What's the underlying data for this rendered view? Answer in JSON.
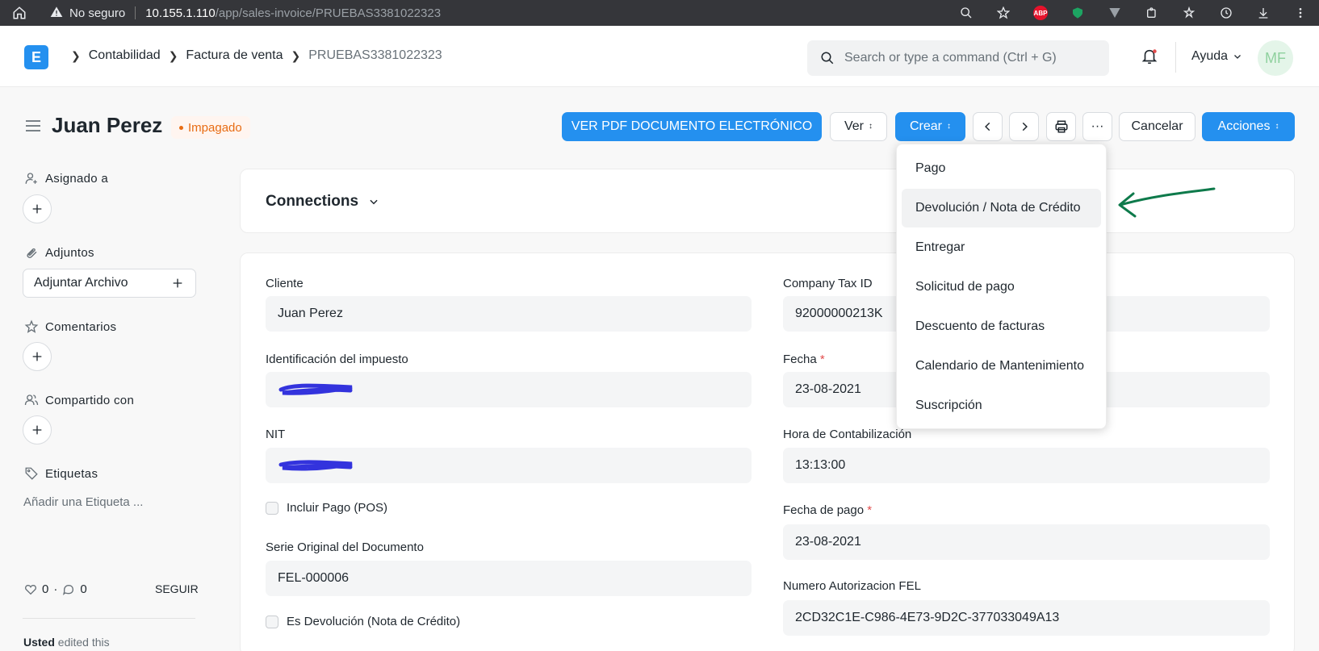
{
  "browser": {
    "security_label": "No seguro",
    "url_host": "10.155.1.110",
    "url_path": "/app/sales-invoice/PRUEBAS3381022323",
    "extension_abp": "ABP"
  },
  "navbar": {
    "logo_letter": "E",
    "breadcrumbs": [
      "Contabilidad",
      "Factura de venta",
      "PRUEBAS3381022323"
    ],
    "search_placeholder": "Search or type a command (Ctrl + G)",
    "help_label": "Ayuda",
    "avatar_initials": "MF"
  },
  "page": {
    "title": "Juan Perez",
    "status": "Impagado",
    "status_color": "#e86c13",
    "accent_color": "#2490ef",
    "buttons": {
      "pdf": "VER PDF DOCUMENTO ELECTRÓNICO",
      "view": "Ver",
      "create": "Crear",
      "more": "···",
      "cancel": "Cancelar",
      "actions": "Acciones"
    }
  },
  "sidebar": {
    "assigned": "Asignado a",
    "attachments": "Adjuntos",
    "attach_file": "Adjuntar Archivo",
    "comments": "Comentarios",
    "shared": "Compartido con",
    "tags": "Etiquetas",
    "add_tag": "Añadir una Etiqueta ...",
    "likes": "0",
    "comment_count": "0",
    "follow": "SEGUIR",
    "edited_user": "Usted",
    "edited_text": " edited this"
  },
  "connections": {
    "title": "Connections"
  },
  "form": {
    "cliente_label": "Cliente",
    "cliente_value": "Juan Perez",
    "tax_id_label": "Identificación del impuesto",
    "nit_label": "NIT",
    "pos_label": "Incluir Pago (POS)",
    "serie_label": "Serie Original del Documento",
    "serie_value": "FEL-000006",
    "return_label": "Es Devolución (Nota de Crédito)",
    "company_tax_label": "Company Tax ID",
    "company_tax_value": "92000000213K",
    "fecha_label": "Fecha",
    "fecha_value": "23-08-2021",
    "hora_label": "Hora de Contabilización",
    "hora_value": "13:13:00",
    "fecha_pago_label": "Fecha de pago",
    "fecha_pago_value": "23-08-2021",
    "fel_label": "Numero Autorizacion FEL",
    "fel_value": "2CD32C1E-C986-4E73-9D2C-377033049A13",
    "required_mark": "*"
  },
  "create_menu": {
    "items": [
      "Pago",
      "Devolución / Nota de Crédito",
      "Entregar",
      "Solicitud de pago",
      "Descuento de facturas",
      "Calendario de Mantenimiento",
      "Suscripción"
    ],
    "highlighted_index": 1
  }
}
